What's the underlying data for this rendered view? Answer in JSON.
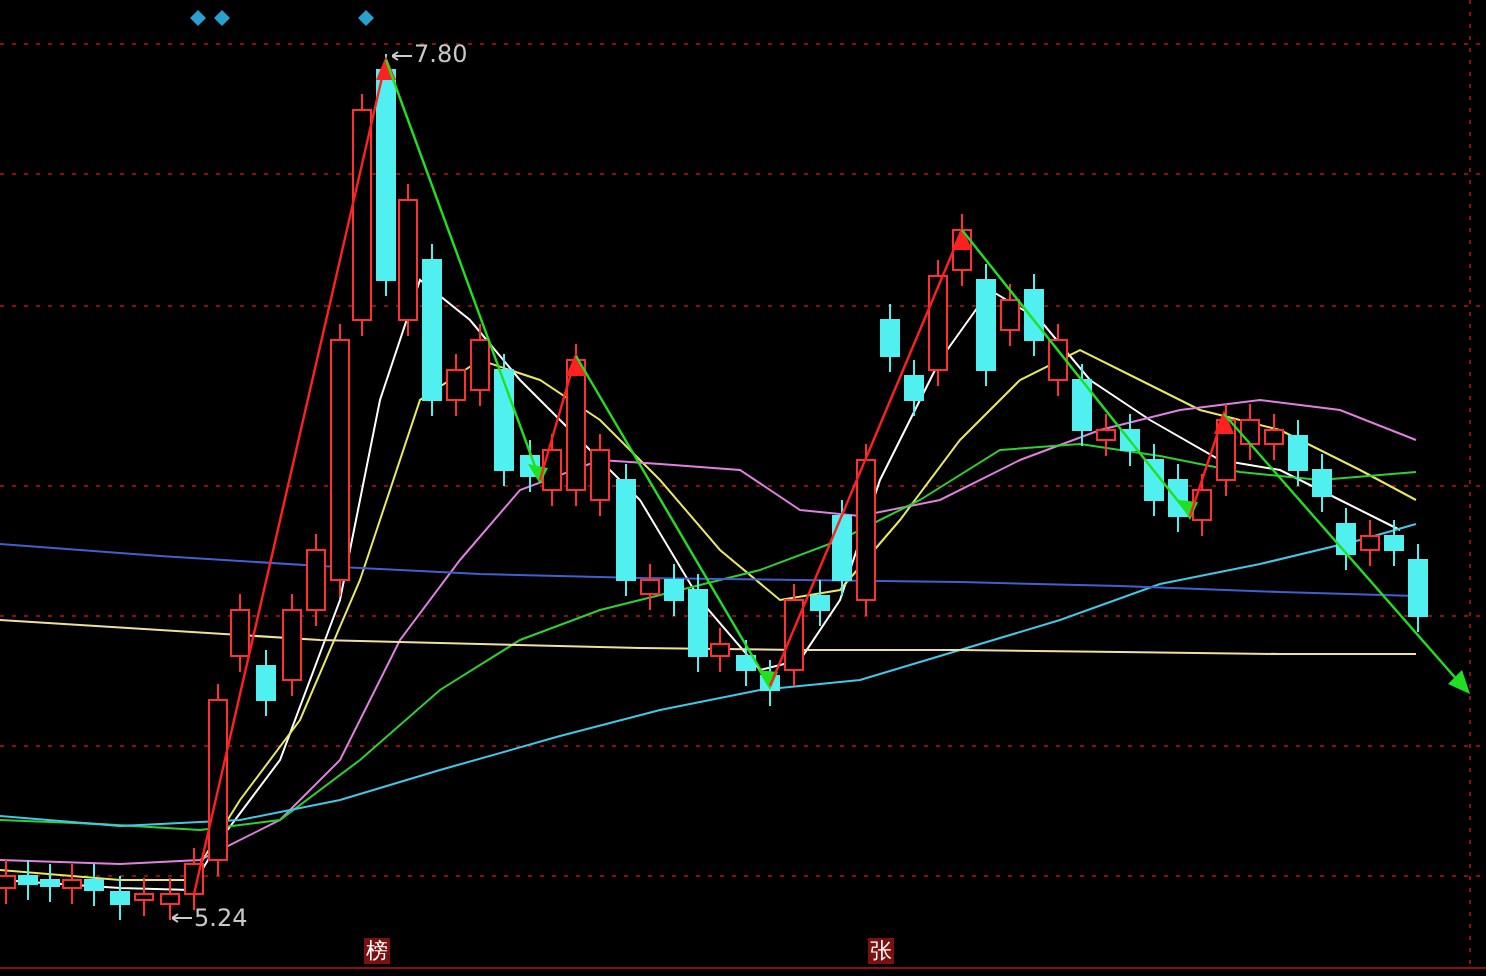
{
  "chart": {
    "high_label": "7.80",
    "low_label": "5.24",
    "signal_markers": [
      {
        "text": "榜"
      },
      {
        "text": "张"
      }
    ]
  }
}
